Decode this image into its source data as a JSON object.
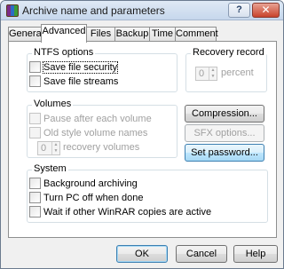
{
  "window": {
    "title": "Archive name and parameters",
    "help_glyph": "?",
    "close_glyph": "✕"
  },
  "tabs": [
    {
      "label": "General",
      "active": false
    },
    {
      "label": "Advanced",
      "active": true
    },
    {
      "label": "Files",
      "active": false
    },
    {
      "label": "Backup",
      "active": false
    },
    {
      "label": "Time",
      "active": false
    },
    {
      "label": "Comment",
      "active": false
    }
  ],
  "ntfs": {
    "title": "NTFS options",
    "save_security": {
      "label": "Save file security",
      "checked": false
    },
    "save_streams": {
      "label": "Save file streams",
      "checked": false
    }
  },
  "recovery": {
    "title": "Recovery record",
    "value": "0",
    "unit": "percent"
  },
  "volumes": {
    "title": "Volumes",
    "pause": {
      "label": "Pause after each volume",
      "checked": false
    },
    "old_style": {
      "label": "Old style volume names",
      "checked": false
    },
    "recovery_value": "0",
    "recovery_label": "recovery volumes"
  },
  "buttons": {
    "compression": "Compression...",
    "sfx": "SFX options...",
    "set_password": "Set password..."
  },
  "system": {
    "title": "System",
    "background": {
      "label": "Background archiving",
      "checked": false
    },
    "turn_off": {
      "label": "Turn PC off when done",
      "checked": false
    },
    "wait": {
      "label": "Wait if other WinRAR copies are active",
      "checked": false
    }
  },
  "footer": {
    "ok": "OK",
    "cancel": "Cancel",
    "help": "Help"
  }
}
